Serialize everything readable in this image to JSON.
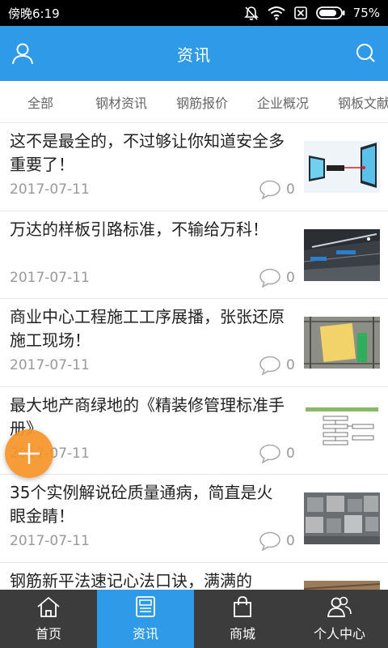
{
  "status_bar": {
    "time": "傍晚6:19",
    "battery_percent": "75%",
    "icons": [
      "mute-icon",
      "wifi-icon",
      "sim-icon",
      "battery-icon"
    ]
  },
  "header": {
    "title": "资讯",
    "left_icon": "user-icon",
    "right_icon": "search-icon",
    "color": "#2f9ae8"
  },
  "tabs": [
    {
      "label": "全部"
    },
    {
      "label": "钢材资讯"
    },
    {
      "label": "钢筋报价"
    },
    {
      "label": "企业概况"
    },
    {
      "label": "钢板文献"
    }
  ],
  "articles": [
    {
      "title": "这不是最全的，不过够让你知道安全多重要了！",
      "date": "2017-07-11",
      "comments": "0"
    },
    {
      "title": "万达的样板引路标准，不输给万科！",
      "date": "2017-07-11",
      "comments": "0"
    },
    {
      "title": "商业中心工程施工工序展播，张张还原施工现场！",
      "date": "2017-07-11",
      "comments": "0"
    },
    {
      "title": "最大地产商绿地的《精装修管理标准手册》",
      "date": "2017-07-11",
      "comments": "0"
    },
    {
      "title": "35个实例解说砼质量通病，简直是火眼金睛！",
      "date": "2017-07-11",
      "comments": "0"
    },
    {
      "title": "钢筋新平法速记心法口诀，满满的",
      "date": "",
      "comments": ""
    }
  ],
  "fab": {
    "icon": "plus-icon",
    "color": "#f59428"
  },
  "bottom_nav": [
    {
      "label": "首页",
      "icon": "home-icon",
      "active": false
    },
    {
      "label": "资讯",
      "icon": "news-icon",
      "active": true
    },
    {
      "label": "商城",
      "icon": "shopping-bag-icon",
      "active": false
    },
    {
      "label": "个人中心",
      "icon": "users-icon",
      "active": false
    }
  ]
}
